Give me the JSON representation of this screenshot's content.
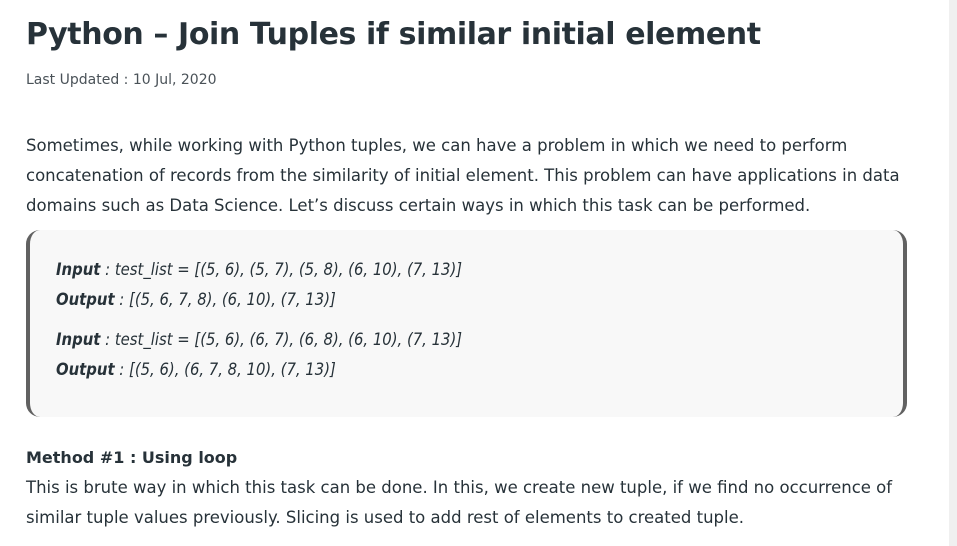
{
  "article": {
    "title": "Python – Join Tuples if similar initial element",
    "last_updated": "Last Updated : 10 Jul, 2020",
    "intro": "Sometimes, while working with Python tuples, we can have a problem in which we need to perform concatenation of records from the similarity of initial element. This problem can have applications in data domains such as Data Science. Let’s discuss certain ways in which this task can be performed.",
    "examples": [
      {
        "label": "Input",
        "sep": " : ",
        "value": "test_list = [(5, 6), (5, 7), (5, 8), (6, 10), (7, 13)]"
      },
      {
        "label": "Output",
        "sep": " : ",
        "value": "[(5, 6, 7, 8), (6, 10), (7, 13)]"
      },
      {
        "label": "Input",
        "sep": " : ",
        "value": "test_list = [(5, 6), (6, 7), (6, 8), (6, 10), (7, 13)]"
      },
      {
        "label": "Output",
        "sep": " : ",
        "value": "[(5, 6), (6, 7, 8, 10), (7, 13)]"
      }
    ],
    "method_heading": "Method #1 : Using loop",
    "method_text": "This is brute way in which this task can be done. In this, we create new tuple, if we find no occurrence of similar tuple values previously. Slicing is used to add rest of elements to created tuple."
  },
  "colors": {
    "text": "#273239",
    "muted": "#4a5258",
    "box_bg": "#f8f8f8",
    "box_border": "#616161"
  }
}
